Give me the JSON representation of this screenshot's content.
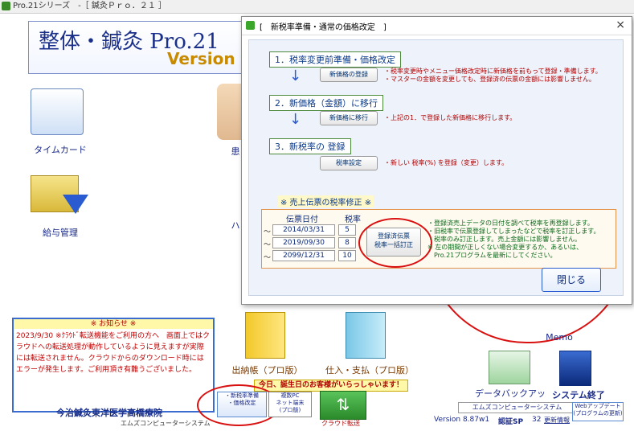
{
  "window": {
    "title": "Pro.21シリーズ　-［ 鍼灸Ｐｒｏ．２１ ］"
  },
  "app": {
    "title": "整体・鍼灸 Pro.21",
    "version_label": "Version 8"
  },
  "tiles": {
    "timecard": "タイムカード",
    "payroll": "給与管理",
    "patient_partial": "患",
    "ha_partial": "ハ",
    "shutsunou": "出納帳（プロ版）",
    "shiire": "仕入・支払（プロ版）",
    "data_backup": "データバックアップ",
    "system_exit": "システム終了",
    "memo": "Memo"
  },
  "notice": {
    "header": "※ お知らせ ※",
    "text": "2023/9/30 ※ｸﾗｳﾄﾞ転送機能をご利用の方へ　画面上ではクラウドへの転送処理が動作しているように見えますが実際には転送されません。クラウドからのダウンロード時にはエラーが発生します。ご利用頂き有難うございました。"
  },
  "birthday_banner": "今日、誕生日のお客様がいらっしゃいます！",
  "bottom": {
    "clinic_name": "今治鍼灸東洋医学高橋療院",
    "company_small": "エムズコンピューターシステム",
    "tax_btn_line1": "・新税率準備",
    "tax_btn_line2": "・価格改定",
    "pc_btn_line1": "複数PC",
    "pc_btn_line2": "ネット端末",
    "pc_btn_line3": "(プロ版)",
    "cloud_label": "クラウド転送",
    "company": "エムズコンピューターシステム",
    "version": "Version 8.87w1",
    "ninsho": "認証SP",
    "count": "32",
    "update_info": "更新情報",
    "web_update_line1": "Webアップデート",
    "web_update_line2": "(プログラムの更新)"
  },
  "dialog": {
    "title": "[　新税率準備・通常の価格改定　]",
    "close_x": "×",
    "step1": "1．税率変更前準備・価格改定",
    "step1_btn": "新価格の登録",
    "step1_note1": "・税率変更時やメニュー価格改定時に新価格を前もって登録・準備します。",
    "step1_note2": "・マスターの金額を変更しても、登録済の伝票の金額には影響しません。",
    "step2": "2．新価格（金額）に移行",
    "step2_btn": "新価格に移行",
    "step2_note": "・上記の1．で登録した新価格に移行します。",
    "step3": "3．新税率の 登録",
    "step3_btn": "税率設定",
    "step3_note": "・新しい 税率(%) を登録（変更）します。",
    "revision_title": "※ 売上伝票の税率修正 ※",
    "col_date": "伝票日付",
    "col_rate": "税率",
    "rows": [
      {
        "tilde": "～",
        "date": "2014/03/31",
        "rate": "5"
      },
      {
        "tilde": "～",
        "date": "2019/09/30",
        "rate": "8"
      },
      {
        "tilde": "～",
        "date": "2099/12/31",
        "rate": "10"
      }
    ],
    "rev_btn_line1": "登録済伝票",
    "rev_btn_line2": "税率一括訂正",
    "rev_note1": "・登録済売上データの日付を調べて税率を再登録します。",
    "rev_note2": "・旧税率で伝票登録してしまったなどで税率を訂正します。",
    "rev_note3": "・税率のみ訂正します。売上金額には影響しません。",
    "rev_note4": "※ 左の期間が正しくない場合変更するか、あるいは、",
    "rev_note5": "Pro.21プログラムを最新にしてください。",
    "close_btn": "閉じる"
  },
  "colors": {
    "accent": "#1a2f8a",
    "annotation": "#d91010",
    "note_red": "#b00000"
  }
}
